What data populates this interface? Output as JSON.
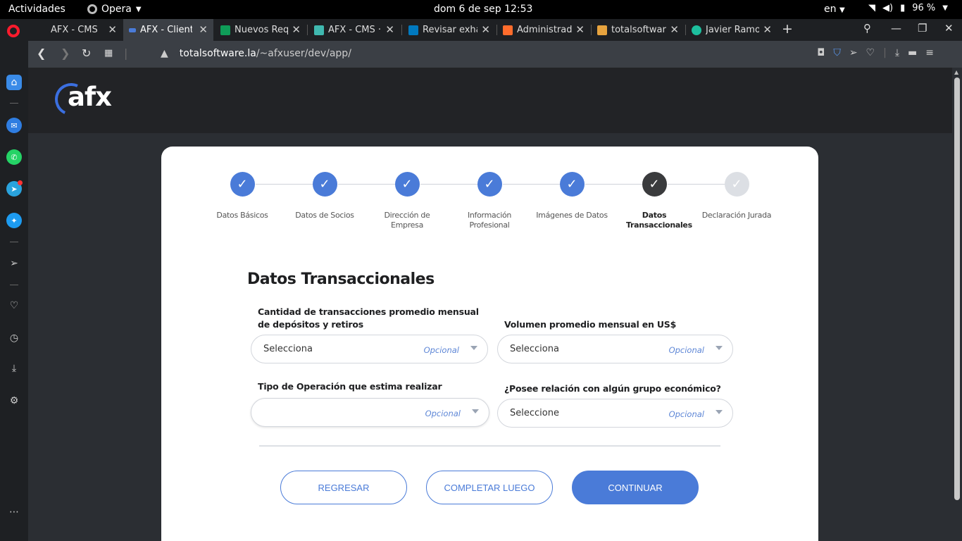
{
  "system": {
    "activities": "Actividades",
    "app_name": "Opera",
    "clock": "dom  6 de sep  12:53",
    "lang": "en",
    "battery": "96 %"
  },
  "tabs": [
    {
      "title": "AFX - CMS",
      "favicon_color": "#1e2023"
    },
    {
      "title": "AFX - Cliente",
      "favicon_color": "#4a7bd8"
    },
    {
      "title": "Nuevos Requ",
      "favicon_color": "#0f9d58"
    },
    {
      "title": "AFX - CMS · A",
      "favicon_color": "#3fb8af"
    },
    {
      "title": "Revisar exha",
      "favicon_color": "#0079bf"
    },
    {
      "title": "Administrado",
      "favicon_color": "#ff6c2c"
    },
    {
      "title": "totalsoftware",
      "favicon_color": "#e7a33e"
    },
    {
      "title": "Javier Ramos",
      "favicon_color": "#1dbf9e"
    }
  ],
  "address": {
    "host": "totalsoftware.la",
    "path": "/~afxuser/dev/app/"
  },
  "page": {
    "steps": [
      {
        "label": "Datos Básicos",
        "state": "done"
      },
      {
        "label": "Datos de Socios",
        "state": "done"
      },
      {
        "label": "Dirección de Empresa",
        "state": "done"
      },
      {
        "label": "Información Profesional",
        "state": "done"
      },
      {
        "label": "Imágenes de Datos",
        "state": "done"
      },
      {
        "label": "Datos Transaccionales",
        "state": "current"
      },
      {
        "label": "Declaración Jurada",
        "state": "pending"
      }
    ],
    "form_title": "Datos Transaccionales",
    "fields": {
      "transactions": {
        "label": "Cantidad de transacciones promedio mensual de depósitos y retiros",
        "value": "Selecciona",
        "hint": "Opcional"
      },
      "volume": {
        "label": "Volumen promedio mensual en US$",
        "value": "Selecciona",
        "hint": "Opcional"
      },
      "operation_type": {
        "label": "Tipo de Operación que estima realizar",
        "value": "",
        "hint": "Opcional"
      },
      "economic_group": {
        "label": "¿Posee relación con algún grupo económico?",
        "value": "Seleccione",
        "hint": "Opcional"
      }
    },
    "buttons": {
      "back": "REGRESAR",
      "later": "COMPLETAR LUEGO",
      "continue": "CONTINUAR"
    },
    "colors": {
      "accent": "#4a7bd8",
      "current_step": "#3a3b3d"
    }
  }
}
